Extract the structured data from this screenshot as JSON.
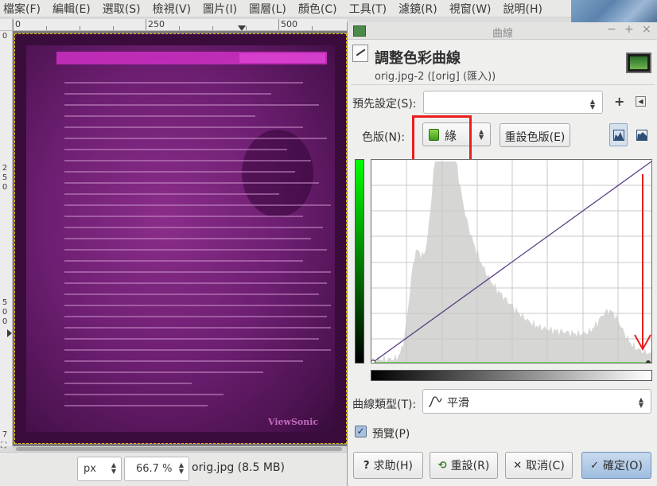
{
  "menubar": {
    "items": [
      "檔案(F)",
      "編輯(E)",
      "選取(S)",
      "檢視(V)",
      "圖片(I)",
      "圖層(L)",
      "顏色(C)",
      "工具(T)",
      "濾鏡(R)",
      "視窗(W)",
      "說明(H)"
    ]
  },
  "ruler": {
    "top_labels": [
      "0",
      "250",
      "500"
    ],
    "left_labels": [
      "0",
      "2",
      "5",
      "0",
      "5",
      "0",
      "0",
      "7"
    ]
  },
  "canvas": {
    "brand_text": "ViewSonic"
  },
  "statusbar": {
    "unit": "px",
    "zoom": "66.7 %",
    "file_info": "orig.jpg (8.5 MB)"
  },
  "dialog": {
    "window_title": "曲線",
    "title": "調整色彩曲線",
    "subtitle": "orig.jpg-2 ([orig] (匯入))",
    "preset_label": "預先設定(S):",
    "preset_value": "",
    "channel_label": "色版(N):",
    "channel_value": "綠",
    "reset_channel": "重設色版(E)",
    "curve_type_label": "曲線類型(T):",
    "curve_type_value": "平滑",
    "preview_label": "預覽(P)",
    "preview_checked": true,
    "buttons": {
      "help": "求助(H)",
      "reset": "重設(R)",
      "cancel": "取消(C)",
      "ok": "確定(O)"
    }
  },
  "icons": {
    "help": "question-icon",
    "reset": "reset-icon",
    "cancel": "close-icon",
    "ok": "check-icon",
    "linear_histogram": "linear-histogram-icon",
    "log_histogram": "log-histogram-icon",
    "curve_type": "smooth-curve-icon",
    "add_preset": "plus-icon",
    "preset_menu": "menu-arrow-icon"
  },
  "colors": {
    "channel": "#4cbd1f",
    "annotation": "#ee1c1c",
    "curve_line": "#5b3d84",
    "histogram": "#d6d6d4"
  }
}
